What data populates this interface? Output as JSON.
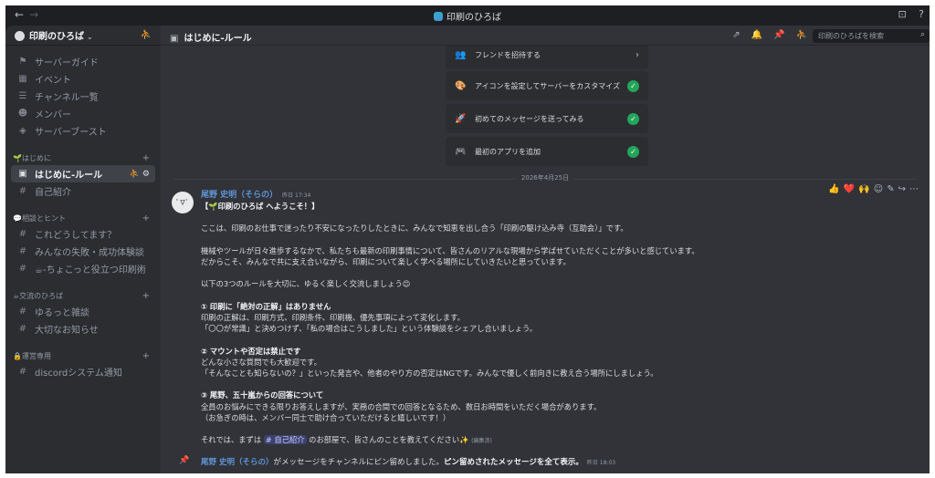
{
  "app": {
    "title": "印刷のひろば",
    "back_icon": "←",
    "forward_icon": "→",
    "inbox_icon": "⊡",
    "help_icon": "?"
  },
  "server": {
    "name": "印刷のひろば",
    "chevron": "⌄",
    "invite_icon": "⛹"
  },
  "sidebar": {
    "top_items": [
      {
        "label": "サーバーガイド",
        "icon": "⚑"
      },
      {
        "label": "イベント",
        "icon": "▦"
      },
      {
        "label": "チャンネル一覧",
        "icon": "☰"
      },
      {
        "label": "メンバー",
        "icon": "☻"
      },
      {
        "label": "サーバーブースト",
        "icon": "◈"
      }
    ],
    "categories": [
      {
        "label": "🌱はじめに",
        "plus": "+",
        "channels": [
          {
            "label": "はじめに-ルール",
            "icon": "▣",
            "active": true,
            "right": "⛹ ⚙"
          },
          {
            "label": "自己紹介",
            "icon": "#"
          }
        ]
      },
      {
        "label": "💬相談とヒント",
        "plus": "+",
        "channels": [
          {
            "label": "これどうしてます？",
            "icon": "#"
          },
          {
            "label": "みんなの失敗・成功体験談",
            "icon": "#"
          },
          {
            "label": "☕-ちょこっと役立つ印刷術",
            "icon": "#"
          }
        ]
      },
      {
        "label": "☕交流のひろば",
        "plus": "+",
        "channels": [
          {
            "label": "ゆるっと雑談",
            "icon": "#"
          },
          {
            "label": "大切なお知らせ",
            "icon": "#"
          }
        ]
      },
      {
        "label": "🔒運営専用",
        "plus": "+",
        "channels": [
          {
            "label": "discordシステム通知",
            "icon": "#"
          }
        ]
      }
    ]
  },
  "channel_header": {
    "title": "はじめに-ルール",
    "title_icon": "▣",
    "icons": [
      "⇗",
      "🔔",
      "📌",
      "⛹"
    ],
    "search_placeholder": "印刷のひろばを検索",
    "search_icon": "⌕"
  },
  "onboarding_tasks": [
    {
      "label": "フレンドを招待する",
      "icon": "👥",
      "done": false,
      "arrow": "›"
    },
    {
      "label": "アイコンを設定してサーバーをカスタマイズ",
      "icon": "🎨",
      "done": true
    },
    {
      "label": "初めてのメッセージを送ってみる",
      "icon": "🚀",
      "done": true
    },
    {
      "label": "最初のアプリを追加",
      "icon": "🎮",
      "done": true
    }
  ],
  "check_icon": "✓",
  "date_divider": "2026年4月25日",
  "message": {
    "author": "尾野 史明（そらの）",
    "timestamp": "昨日 17:34",
    "avatar_text": "ﾟ∇ﾟ",
    "lines": {
      "title": "【🌱印刷のひろば へようこそ！】",
      "p1": "ここは、印刷のお仕事で迷ったり不安になったりしたときに、みんなで知恵を出し合う「印刷の駆け込み寺（互助会）」です。",
      "p2a": "機械やツールが日々進歩するなかで、私たちも最新の印刷事情について、皆さんのリアルな現場から学ばせていただくことが多いと感じています。",
      "p2b": "だからこそ、みんなで共に支え合いながら、印刷について楽しく学べる場所にしていきたいと思っています。",
      "p3": "以下の3つのルールを大切に、ゆるく楽しく交流しましょう😊",
      "r1_title": "① 印刷に「絶対の正解」はありません",
      "r1_a": "印刷の正解は、印刷方式、印刷条件、印刷機、優先事項によって変化します。",
      "r1_b": "「〇〇が常識」と決めつけず、「私の場合はこうしました」という体験談をシェアし合いましょう。",
      "r2_title": "② マウントや否定は禁止です",
      "r2_a": "どんな小さな質問でも大歓迎です。",
      "r2_b": "「そんなことも知らないの？」といった発言や、他者のやり方の否定はNGです。みんなで優しく前向きに教え合う場所にしましょう。",
      "r3_title": "③ 尾野、五十嵐からの回答について",
      "r3_a": "全員のお悩みにできる限りお答えしますが、実務の合間での回答となるため、数日お時間をいただく場合があります。",
      "r3_b": "（お急ぎの時は、メンバー同士で助け合っていただけると嬉しいです！）",
      "closing_pre": "それでは、まずは ",
      "closing_mention": "# 自己紹介",
      "closing_post": " のお部屋で、皆さんのことを教えてください✨",
      "edited": "(編集済)"
    },
    "reactions": [
      "👍",
      "❤️",
      "🙌",
      "☺",
      "✎",
      "↪",
      "⋯"
    ]
  },
  "pin_notice": {
    "icon": "📌",
    "author": "尾野 史明（そらの）",
    "text": "がメッセージをチャンネルにピン留めしました。",
    "link": "ピン留めされたメッセージを全て表示。",
    "timestamp": "昨日 18:03"
  },
  "colors": {
    "accent_author": "#5f94d6",
    "check_green": "#23a55a",
    "mention_bg": "#3c4270"
  }
}
